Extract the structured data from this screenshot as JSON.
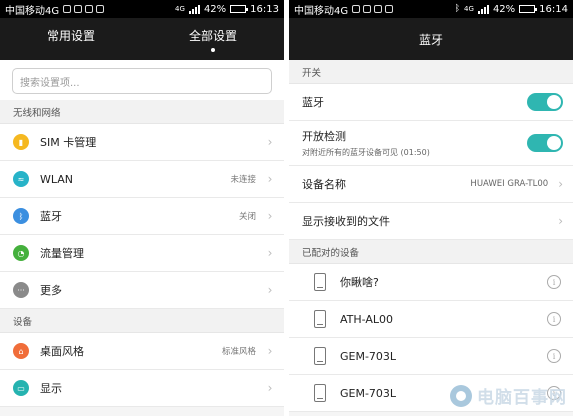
{
  "left": {
    "status": {
      "carrier": "中国移动4G",
      "net": "4G",
      "battery": "42%",
      "battery_level": 0.42,
      "time": "16:13"
    },
    "tabs": [
      {
        "label": "常用设置",
        "active": false
      },
      {
        "label": "全部设置",
        "active": true
      }
    ],
    "search_placeholder": "搜索设置项...",
    "sections": [
      {
        "title": "无线和网络",
        "items": [
          {
            "label": "SIM 卡管理",
            "value": "",
            "icon": "sim-icon",
            "color": "#f5b820"
          },
          {
            "label": "WLAN",
            "value": "未连接",
            "icon": "wifi-icon",
            "color": "#27b3c8"
          },
          {
            "label": "蓝牙",
            "value": "关闭",
            "icon": "bluetooth-icon",
            "color": "#3b8fe0"
          },
          {
            "label": "流量管理",
            "value": "",
            "icon": "data-usage-icon",
            "color": "#45b03d"
          },
          {
            "label": "更多",
            "value": "",
            "icon": "more-icon",
            "color": "#8a8a8a"
          }
        ]
      },
      {
        "title": "设备",
        "items": [
          {
            "label": "桌面风格",
            "value": "标准风格",
            "icon": "home-icon",
            "color": "#f06d3a"
          },
          {
            "label": "显示",
            "value": "",
            "icon": "display-icon",
            "color": "#25b3b0"
          }
        ]
      }
    ]
  },
  "right": {
    "status": {
      "carrier": "中国移动4G",
      "net": "4G",
      "battery": "42%",
      "battery_level": 0.42,
      "time": "16:14"
    },
    "title": "蓝牙",
    "switch_section": "开关",
    "bluetooth_label": "蓝牙",
    "visible_label": "开放检测",
    "visible_sub": "对附近所有的蓝牙设备可见 (01:50)",
    "device_name_label": "设备名称",
    "device_name_value": "HUAWEI GRA-TL00",
    "received_files_label": "显示接收到的文件",
    "paired_section": "已配对的设备",
    "paired_devices": [
      "你瞅啥?",
      "ATH-AL00",
      "GEM-703L",
      "GEM-703L"
    ],
    "toggle_color": "#2fb6b1"
  },
  "watermark": {
    "text": "电脑百事网"
  }
}
